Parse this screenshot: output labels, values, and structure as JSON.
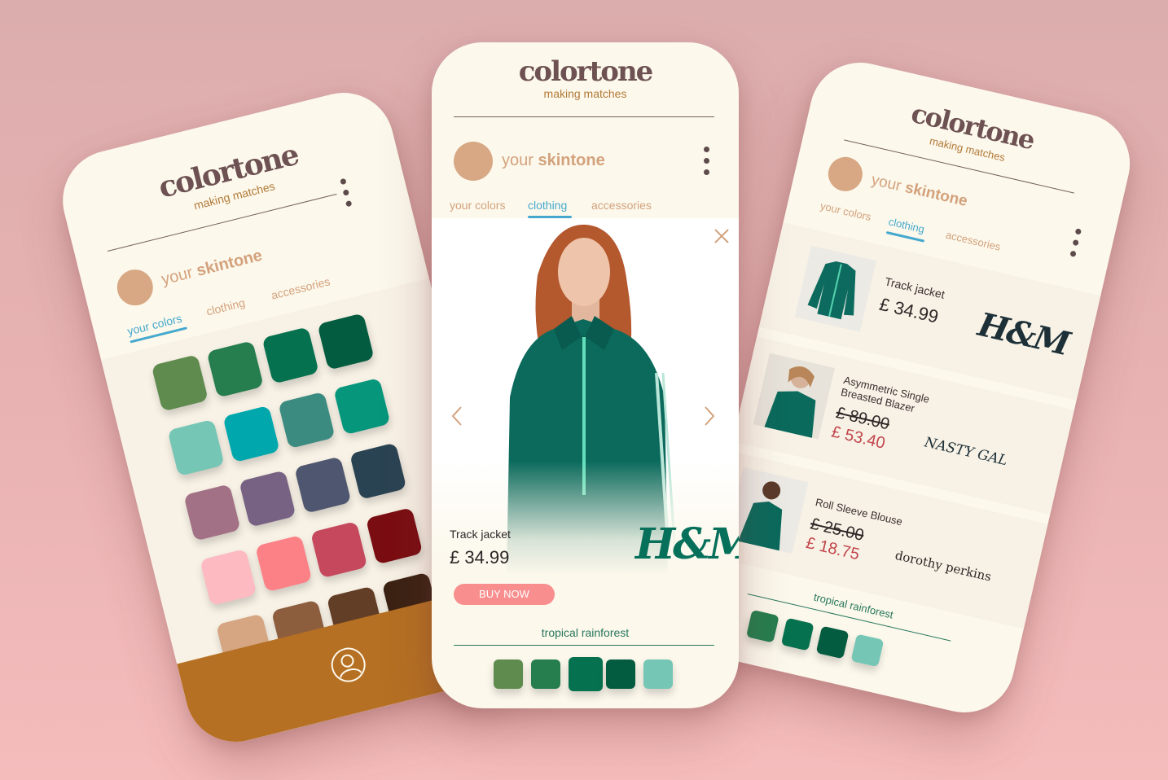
{
  "app": {
    "logo": "colortone",
    "tagline": "making matches"
  },
  "skintone": {
    "prefix": "your",
    "emphasis": "skintone",
    "color": "#d7a883"
  },
  "tabs": [
    "your colors",
    "clothing",
    "accessories"
  ],
  "colors": {
    "accent_blue": "#45a9cd",
    "cream": "#fcf8ec",
    "footer_brown": "#b57023",
    "buy_button": "#f88e8e",
    "sale_red": "#c2454c"
  },
  "left_phone": {
    "active_tab": "your colors",
    "swatches": [
      "#5f8b4f",
      "#267d4e",
      "#06714f",
      "#045c40",
      "#76c6b6",
      "#00a8ad",
      "#3c8b81",
      "#05967b",
      "#a37186",
      "#786283",
      "#4f566f",
      "#2a4353",
      "#fdbbc1",
      "#fc8187",
      "#c5485c",
      "#7a0d12",
      "#d6a582",
      "#8d5e3e",
      "#633e26",
      "#3b2213"
    ],
    "footer_icon": "user-icon"
  },
  "center_phone": {
    "active_tab": "clothing",
    "product": {
      "name": "Track jacket",
      "price": "£  34.99",
      "brand": "H&M"
    },
    "buy_label": "BUY NOW",
    "palette_name": "tropical rainforest",
    "palette": [
      "#5f8b4f",
      "#267d4e",
      "#06714f",
      "#045c40",
      "#76c6b6"
    ],
    "icons": {
      "close": "close-icon",
      "prev": "chevron-left-icon",
      "next": "chevron-right-icon"
    }
  },
  "right_phone": {
    "active_tab": "clothing",
    "items": [
      {
        "name": "Track jacket",
        "price": "£  34.99",
        "old_price": "",
        "brand": "H&M"
      },
      {
        "name": "Asymmetric Single Breasted Blazer",
        "price": "£  53.40",
        "old_price": "£  89.00",
        "brand": "NASTY GAL"
      },
      {
        "name": "Roll Sleeve Blouse",
        "price": "£  18.75",
        "old_price": "£  25.00",
        "brand": "dorothy perkins"
      }
    ],
    "palette_name": "tropical rainforest",
    "palette": [
      "#267d4e",
      "#06714f",
      "#045c40",
      "#76c6b6"
    ]
  }
}
